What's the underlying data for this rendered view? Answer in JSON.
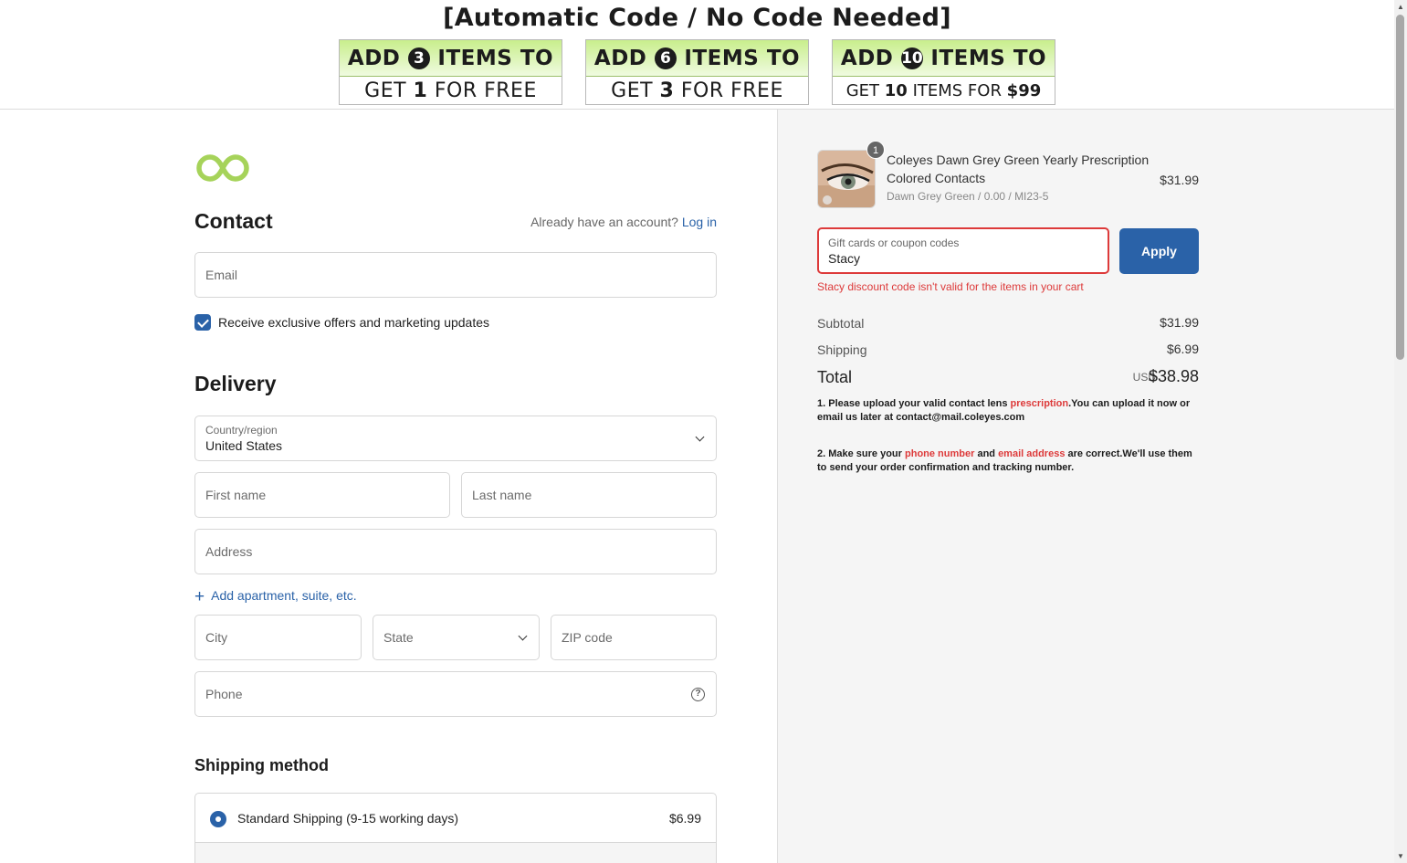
{
  "banner": {
    "title": "[Automatic Code / No Code Needed]",
    "promos": [
      {
        "pre": "ADD ",
        "num": "3",
        "post": " ITEMS TO",
        "b1": "GET ",
        "b1n": "1",
        "b2": " FOR FREE"
      },
      {
        "pre": "ADD ",
        "num": "6",
        "post": " ITEMS TO",
        "b1": "GET ",
        "b1n": "3",
        "b2": " FOR FREE"
      },
      {
        "pre": "ADD ",
        "num": "10",
        "post": " ITEMS TO",
        "b1": "GET ",
        "b1n": "10",
        "b2": " ITEMS FOR ",
        "b3": "$99"
      }
    ]
  },
  "contact": {
    "heading": "Contact",
    "account_prompt": "Already have an account?",
    "login_link": "Log in",
    "email_placeholder": "Email",
    "marketing_label": "Receive exclusive offers and marketing updates",
    "marketing_checked": true
  },
  "delivery": {
    "heading": "Delivery",
    "country_label": "Country/region",
    "country_value": "United States",
    "first_name": "First name",
    "last_name": "Last name",
    "address": "Address",
    "add_apartment": "Add apartment, suite, etc.",
    "city": "City",
    "state": "State",
    "zip": "ZIP code",
    "phone": "Phone"
  },
  "shipping": {
    "heading": "Shipping method",
    "option_name": "Standard Shipping (9-15 working days)",
    "option_price": "$6.99"
  },
  "summary": {
    "item": {
      "quantity": "1",
      "name": "Coleyes Dawn Grey Green Yearly Prescription Colored Contacts",
      "variant": "Dawn Grey Green / 0.00 / MI23-5",
      "price": "$31.99"
    },
    "coupon_label": "Gift cards or coupon codes",
    "coupon_value": "Stacy",
    "apply_label": "Apply",
    "error": "Stacy discount code isn't valid for the items in your cart",
    "subtotal_label": "Subtotal",
    "subtotal_value": "$31.99",
    "shipping_label": "Shipping",
    "shipping_value": "$6.99",
    "total_label": "Total",
    "total_currency": "USD",
    "total_value": "$38.98",
    "note1": {
      "a": "1. Please upload your valid contact lens ",
      "red": "prescription",
      "b": ".You can upload it now or email us later at contact@mail.coleyes.com"
    },
    "note2": {
      "a": "2. Make sure your ",
      "red1": "phone number",
      "b": " and ",
      "red2": "email address",
      "c": " are correct.We'll use them to send your order confirmation and tracking number."
    }
  },
  "colors": {
    "accent": "#2a62a8",
    "error": "#dd3a3a",
    "logo_green": "#a6d35a",
    "promo_green": "#c8ee8c"
  },
  "icons": [
    "logo-infinity-icon",
    "checkbox-check-icon",
    "chevron-down-icon",
    "plus-icon",
    "help-circle-icon",
    "radio-selected-icon"
  ]
}
